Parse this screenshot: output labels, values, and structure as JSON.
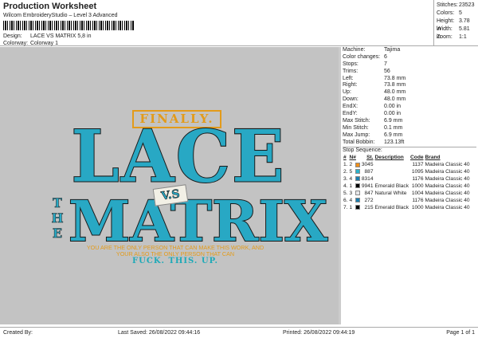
{
  "header": {
    "title": "Production Worksheet",
    "subtitle": "Wilcom EmbroideryStudio – Level 3 Advanced",
    "design_label": "Design:",
    "design_value": "LACE VS MATRIX 5,8 in",
    "colorway_label": "Colorway:",
    "colorway_value": "Colorway 1"
  },
  "stats": [
    {
      "k": "Stitches:",
      "v": "23523"
    },
    {
      "k": "Colors:",
      "v": "5"
    },
    {
      "k": "Height:",
      "v": "3.78 in"
    },
    {
      "k": "Width:",
      "v": "5.81 in"
    },
    {
      "k": "Zoom:",
      "v": "1:1"
    }
  ],
  "artwork": {
    "finally": "FINALLY.",
    "lace": "LACE",
    "vs": "V.S",
    "the": "THE",
    "matrix": "MATRIX",
    "tagline1": "YOU ARE THE ONLY PERSON THAT CAN MAKE THIS WORK, AND",
    "tagline2": "YOUR ALSO THE ONLY PERSON THAT CAN",
    "tagline3": "FUCK. THIS. UP."
  },
  "details": [
    {
      "k": "Machine:",
      "v": "Tajima"
    },
    {
      "k": "Color changes:",
      "v": "6"
    },
    {
      "k": "Stops:",
      "v": "7"
    },
    {
      "k": "Trims:",
      "v": "56"
    },
    {
      "k": "Left:",
      "v": "73.8 mm"
    },
    {
      "k": "Right:",
      "v": "73.8 mm"
    },
    {
      "k": "Up:",
      "v": "48.0 mm"
    },
    {
      "k": "Down:",
      "v": "48.0 mm"
    },
    {
      "k": "EndX:",
      "v": "0.00 in"
    },
    {
      "k": "EndY:",
      "v": "0.00 in"
    },
    {
      "k": "Max Stitch:",
      "v": "6.9 mm"
    },
    {
      "k": "Min Stitch:",
      "v": "0.1 mm"
    },
    {
      "k": "Max Jump:",
      "v": "6.9 mm"
    },
    {
      "k": "Total Bobbin:",
      "v": "123.13ft"
    }
  ],
  "stop_sequence": {
    "title": "Stop Sequence:",
    "headers": [
      "#",
      "N#",
      "St.",
      "Description",
      "Code",
      "Brand"
    ],
    "rows": [
      {
        "n": "1.",
        "nn": "2",
        "color": "#f0901a",
        "st": "3045",
        "desc": "",
        "code": "1137",
        "brand": "Madeira Classic 40"
      },
      {
        "n": "2.",
        "nn": "5",
        "color": "#2bb3cc",
        "st": "887",
        "desc": "",
        "code": "1095",
        "brand": "Madeira Classic 40"
      },
      {
        "n": "3.",
        "nn": "4",
        "color": "#1a7fb0",
        "st": "8314",
        "desc": "",
        "code": "1176",
        "brand": "Madeira Classic 40"
      },
      {
        "n": "4.",
        "nn": "1",
        "color": "#000000",
        "st": "9941",
        "desc": "Emerald Black",
        "code": "1000",
        "brand": "Madeira Classic 40"
      },
      {
        "n": "5.",
        "nn": "3",
        "color": "#e8e8ea",
        "st": "847",
        "desc": "Natural White",
        "code": "1004",
        "brand": "Madeira Classic 40"
      },
      {
        "n": "6.",
        "nn": "4",
        "color": "#1a7fb0",
        "st": "272",
        "desc": "",
        "code": "1176",
        "brand": "Madeira Classic 40"
      },
      {
        "n": "7.",
        "nn": "1",
        "color": "#000000",
        "st": "215",
        "desc": "Emerald Black",
        "code": "1000",
        "brand": "Madeira Classic 40"
      }
    ]
  },
  "footer": {
    "created": "Created By:",
    "saved": "Last Saved: 26/08/2022 09:44:16",
    "printed": "Printed: 26/08/2022 09:44:19",
    "page": "Page 1 of 1"
  }
}
